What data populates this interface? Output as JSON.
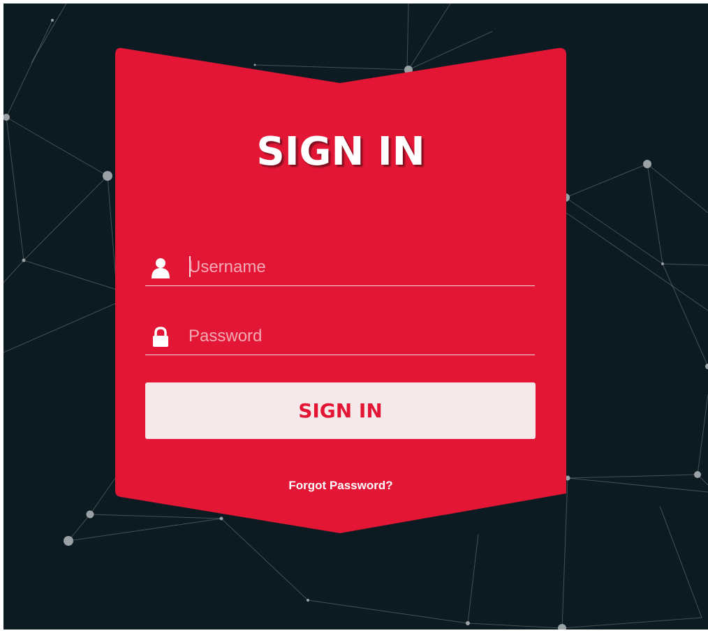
{
  "form": {
    "title": "SIGN IN",
    "username": {
      "placeholder": "Username",
      "value": "",
      "icon": "user-icon"
    },
    "password": {
      "placeholder": "Password",
      "value": "",
      "icon": "lock-icon"
    },
    "submit_label": "SIGN IN",
    "forgot_label": "Forgot Password?"
  },
  "colors": {
    "background": "#0c1a21",
    "card": "#e31735",
    "button": "#f5e9ea",
    "button_text": "#e31735",
    "text": "#ffffff"
  }
}
